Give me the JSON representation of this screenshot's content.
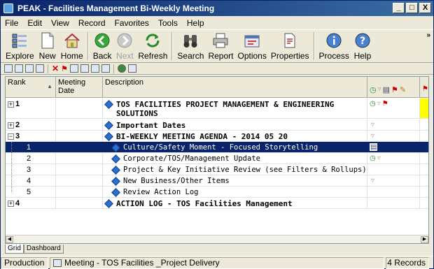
{
  "window": {
    "title": "PEAK - Facilities Management Bi-Weekly Meeting",
    "controls": [
      "_",
      "□",
      "X"
    ]
  },
  "menu": [
    "File",
    "Edit",
    "View",
    "Record",
    "Favorites",
    "Tools",
    "Help"
  ],
  "toolbar": {
    "buttons": [
      {
        "label": "Explore",
        "icon": "explore-icon"
      },
      {
        "label": "New",
        "icon": "new-document-icon"
      },
      {
        "label": "Home",
        "icon": "home-icon"
      },
      {
        "label": "Back",
        "icon": "back-arrow-icon"
      },
      {
        "label": "Next",
        "icon": "next-arrow-icon",
        "disabled": true
      },
      {
        "label": "Refresh",
        "icon": "refresh-icon"
      },
      {
        "label": "Search",
        "icon": "binoculars-icon"
      },
      {
        "label": "Report",
        "icon": "printer-icon"
      },
      {
        "label": "Options",
        "icon": "options-icon"
      },
      {
        "label": "Properties",
        "icon": "properties-icon"
      },
      {
        "label": "Process",
        "icon": "info-icon"
      },
      {
        "label": "Help",
        "icon": "help-icon"
      }
    ],
    "overflow": "»"
  },
  "grid": {
    "columns": [
      "Rank",
      "Meeting Date",
      "Description"
    ],
    "rows": [
      {
        "rank": "1",
        "expander": "+",
        "desc": "TOS FACILITIES PROJECT MANAGEMENT & ENGINEERING SOLUTIONS",
        "bold": true
      },
      {
        "rank": "2",
        "expander": "+",
        "desc": "Important Dates",
        "bold": true
      },
      {
        "rank": "3",
        "expander": "−",
        "desc": "BI-WEEKLY MEETING AGENDA - 2014 05 20",
        "bold": true
      },
      {
        "rank": "1",
        "desc": "Culture/Safety Moment - Focused Storytelling",
        "selected": true
      },
      {
        "rank": "2",
        "desc": "Corporate/TOS/Management Update"
      },
      {
        "rank": "3",
        "desc": "Project & Key Initiative Review (see Filters & Rollups)"
      },
      {
        "rank": "4",
        "desc": "New Business/Other Items"
      },
      {
        "rank": "5",
        "desc": "Review Action Log"
      },
      {
        "rank": "4",
        "expander": "+",
        "desc": "ACTION LOG - TOS Facilities Management",
        "bold": true
      }
    ]
  },
  "tabs": [
    "Grid",
    "Dashboard"
  ],
  "status": {
    "mode": "Production",
    "context": "Meeting - TOS Facilities _Project Delivery",
    "records": "4 Records"
  },
  "colors": {
    "titlebar": "#0a246a",
    "selection": "#0a246a",
    "highlight": "#ffff00",
    "diamond": "#2c6fd0"
  }
}
